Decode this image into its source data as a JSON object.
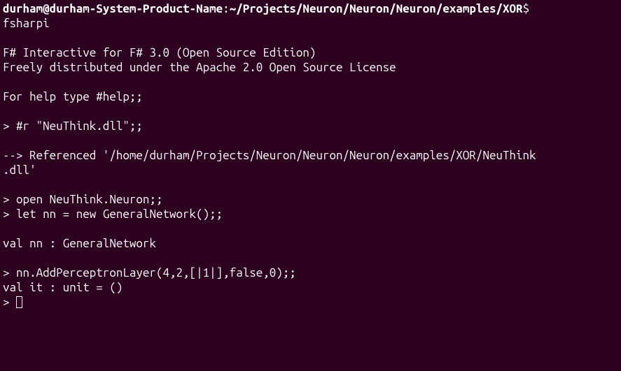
{
  "prompt": {
    "user_host": "durham@durham-System-Product-Name",
    "separator": ":",
    "path": "~/Projects/Neuron/Neuron/Neuron/examples/XOR",
    "symbol": "$ "
  },
  "lines": {
    "cmd_fsharpi": "fsharpi",
    "blank": "",
    "banner1": "F# Interactive for F# 3.0 (Open Source Edition)",
    "banner2": "Freely distributed under the Apache 2.0 Open Source License",
    "help_hint": "For help type #help;;",
    "input_ref": "> #r \"NeuThink.dll\";;",
    "ref_output1": "--> Referenced '/home/durham/Projects/Neuron/Neuron/Neuron/examples/XOR/NeuThink",
    "ref_output2": ".dll'",
    "input_open": "> open NeuThink.Neuron;;",
    "input_let": "> let nn = new GeneralNetwork();;",
    "val_nn": "val nn : GeneralNetwork",
    "input_add": "> nn.AddPerceptronLayer(4,2,[|1|],false,0);;",
    "val_it": "val it : unit = ()",
    "prompt_empty": "> "
  }
}
